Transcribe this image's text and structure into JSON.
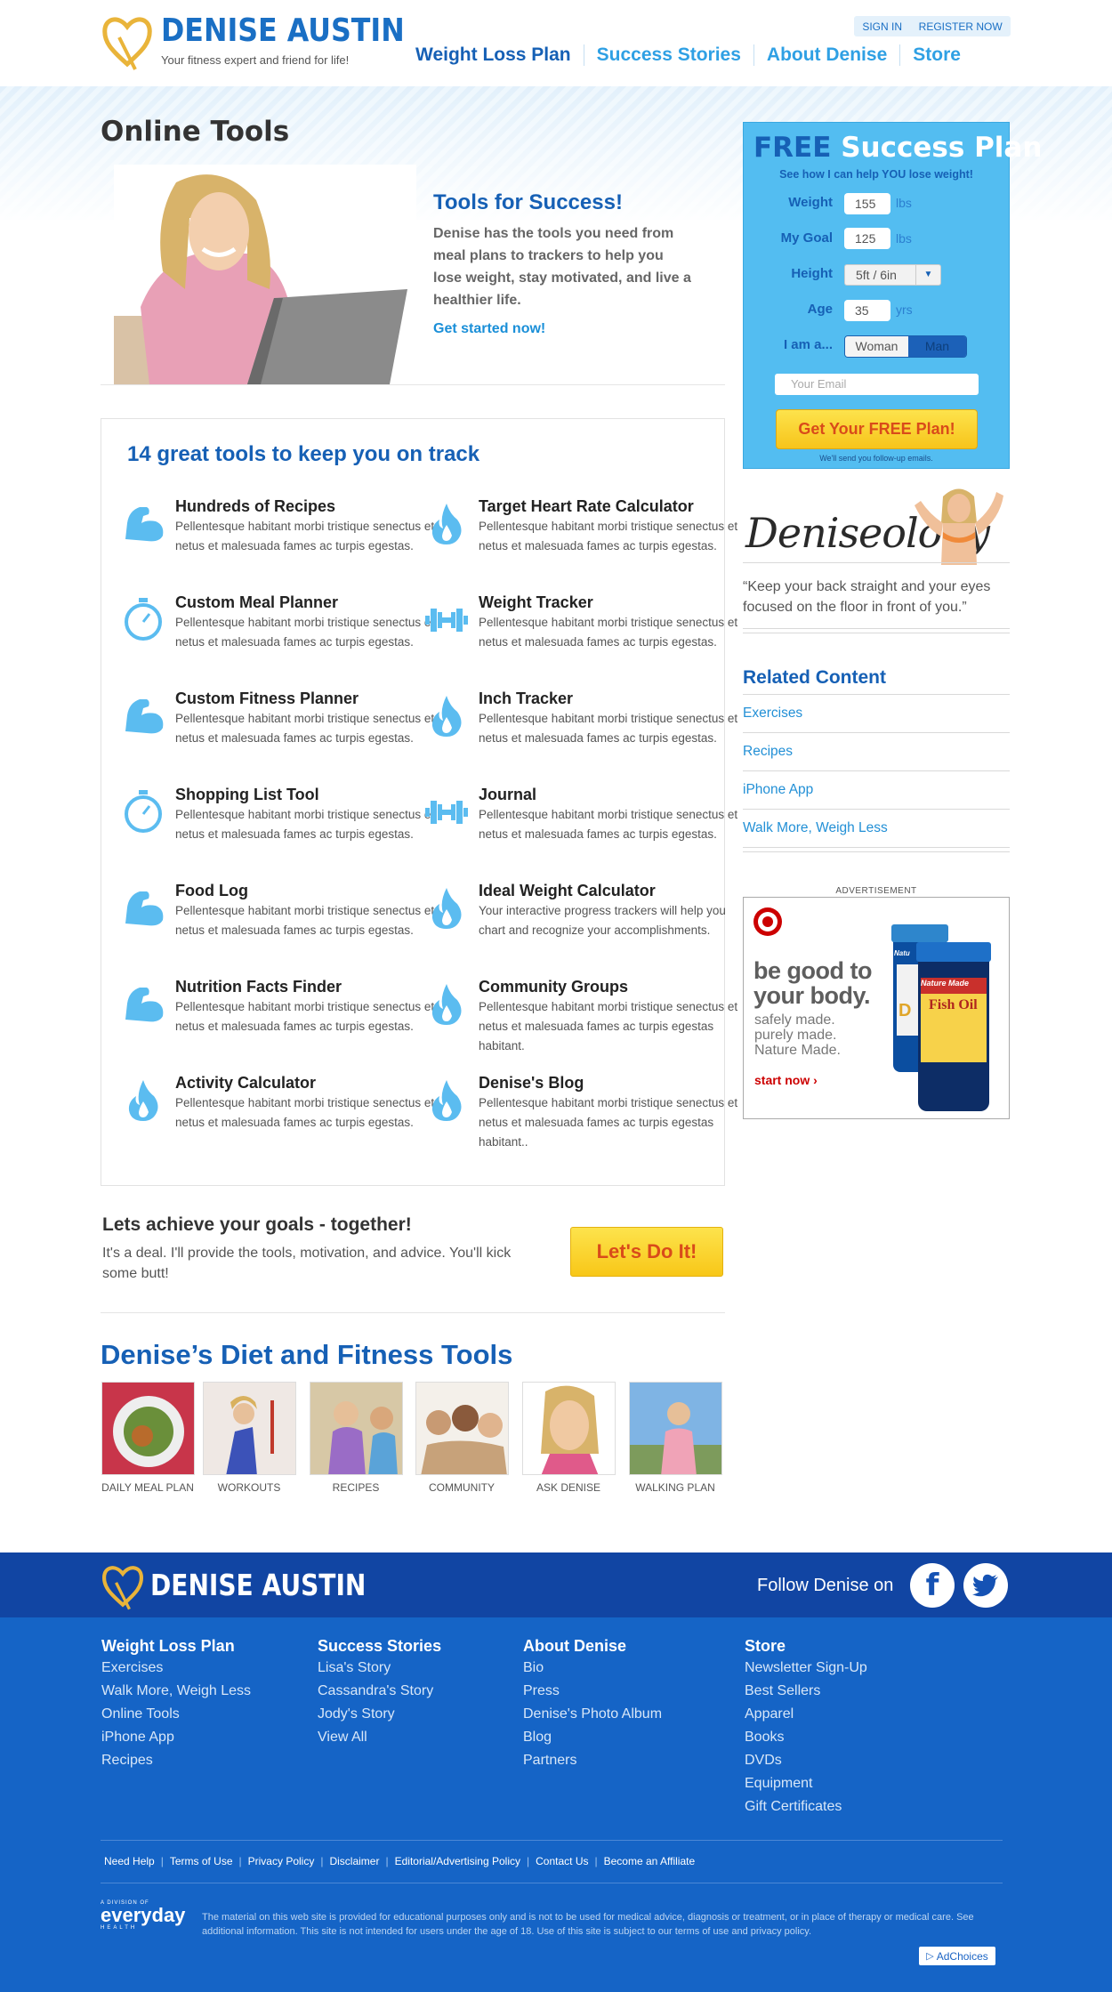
{
  "header": {
    "brand": "DENISE AUSTIN",
    "tagline": "Your fitness expert and friend for life!",
    "sign_in": "SIGN IN",
    "register": "REGISTER NOW",
    "nav": [
      "Weight Loss Plan",
      "Success Stories",
      "About Denise",
      "Store"
    ]
  },
  "page_title": "Online Tools",
  "hero": {
    "heading": "Tools for Success!",
    "body": "Denise has the tools you need from meal plans to trackers to help you lose weight, stay motivated, and live a healthier life.",
    "cta": "Get started now!"
  },
  "tools": {
    "title": "14 great tools to keep you on track",
    "items": [
      {
        "name": "Hundreds of Recipes",
        "desc": "Pellentesque habitant morbi tristique senectus et netus et malesuada fames ac turpis egestas.",
        "icon": "flexed-arm-icon"
      },
      {
        "name": "Target Heart Rate Calculator",
        "desc": "Pellentesque habitant morbi tristique senectus et netus et malesuada fames ac turpis egestas.",
        "icon": "flame-icon"
      },
      {
        "name": "Custom Meal Planner",
        "desc": "Pellentesque habitant morbi tristique senectus et netus et malesuada fames ac turpis egestas.",
        "icon": "stopwatch-icon"
      },
      {
        "name": "Weight Tracker",
        "desc": "Pellentesque habitant morbi tristique senectus et netus et malesuada fames ac turpis egestas.",
        "icon": "dumbbell-icon"
      },
      {
        "name": "Custom Fitness Planner",
        "desc": "Pellentesque habitant morbi tristique senectus et netus et malesuada fames ac turpis egestas.",
        "icon": "flexed-arm-icon"
      },
      {
        "name": "Inch Tracker",
        "desc": "Pellentesque habitant morbi tristique senectus et netus et malesuada fames ac turpis egestas.",
        "icon": "flame-icon"
      },
      {
        "name": "Shopping List Tool",
        "desc": "Pellentesque habitant morbi tristique senectus et netus et malesuada fames ac turpis egestas.",
        "icon": "stopwatch-icon"
      },
      {
        "name": "Journal",
        "desc": "Pellentesque habitant morbi tristique senectus et netus et malesuada fames ac turpis egestas.",
        "icon": "dumbbell-icon"
      },
      {
        "name": "Food Log",
        "desc": "Pellentesque habitant morbi tristique senectus et netus et malesuada fames ac turpis egestas.",
        "icon": "flexed-arm-icon"
      },
      {
        "name": "Ideal Weight Calculator",
        "desc": "Your interactive progress trackers will help you chart and recognize your accomplishments.",
        "icon": "flame-icon"
      },
      {
        "name": "Nutrition Facts Finder",
        "desc": "Pellentesque habitant morbi tristique senectus et netus et malesuada fames ac turpis egestas.",
        "icon": "flexed-arm-icon"
      },
      {
        "name": "Community Groups",
        "desc": "Pellentesque habitant morbi tristique senectus et netus et malesuada fames ac turpis egestas habitant.",
        "icon": "flame-icon"
      },
      {
        "name": "Activity Calculator",
        "desc": "Pellentesque habitant morbi tristique senectus et netus et malesuada fames ac turpis egestas.",
        "icon": "flame-icon"
      },
      {
        "name": "Denise's Blog",
        "desc": "Pellentesque habitant morbi tristique senectus et netus et malesuada fames ac turpis egestas habitant..",
        "icon": "flame-icon"
      }
    ]
  },
  "goals": {
    "heading": "Lets achieve your goals - together!",
    "body": "It's a deal.  I'll provide the tools, motivation, and advice.  You'll kick some butt!",
    "button": "Let's Do It!"
  },
  "diet_tools": {
    "title": "Denise’s Diet and Fitness Tools",
    "items": [
      "DAILY MEAL PLAN",
      "WORKOUTS",
      "RECIPES",
      "COMMUNITY",
      "ASK DENISE",
      "WALKING PLAN"
    ]
  },
  "plan": {
    "title_free": "FREE",
    "title_rest": "Success Plan",
    "subtitle": "See how I can help YOU lose weight!",
    "weight_label": "Weight",
    "weight_value": "155",
    "weight_unit": "lbs",
    "goal_label": "My Goal",
    "goal_value": "125",
    "goal_unit": "lbs",
    "height_label": "Height",
    "height_value": "5ft / 6in",
    "age_label": "Age",
    "age_value": "35",
    "age_unit": "yrs",
    "gender_label": "I am a...",
    "gender_woman": "Woman",
    "gender_man": "Man",
    "email_placeholder": "Your Email",
    "button": "Get Your FREE Plan!",
    "note": "We'll send you follow-up emails."
  },
  "deniseology": {
    "logo": "Deniseology",
    "quote": "“Keep your back straight and your eyes focused on the floor in front of you.”"
  },
  "related": {
    "title": "Related Content",
    "items": [
      "Exercises",
      "Recipes",
      "iPhone App",
      "Walk More, Weigh Less"
    ]
  },
  "ad": {
    "label": "ADVERTISEMENT",
    "headline": "be good to your body.",
    "sub1": "safely made.",
    "sub2": "purely made.",
    "sub3": "Nature Made.",
    "cta": "start now",
    "bottle_brand": "Nature Made",
    "bottle_product": "Fish Oil",
    "bottle_partial": "D",
    "bottle_partial_brand": "Natu"
  },
  "footer": {
    "brand": "DENISE AUSTIN",
    "follow": "Follow Denise on",
    "columns": [
      {
        "heading": "Weight Loss Plan",
        "links": [
          "Exercises",
          "Walk More, Weigh Less",
          "Online Tools",
          "iPhone App",
          "Recipes"
        ]
      },
      {
        "heading": "Success Stories",
        "links": [
          "Lisa's Story",
          "Cassandra's Story",
          "Jody's Story",
          "View All"
        ]
      },
      {
        "heading": "About Denise",
        "links": [
          "Bio",
          "Press",
          "Denise's Photo Album",
          "Blog",
          "Partners"
        ]
      },
      {
        "heading": "Store",
        "links": [
          "Newsletter Sign-Up",
          "Best Sellers",
          "Apparel",
          "Books",
          "DVDs",
          "Equipment",
          "Gift Certificates"
        ]
      }
    ],
    "bottom_links": [
      "Need Help",
      "Terms of Use",
      "Privacy Policy",
      "Disclaimer",
      "Editorial/Advertising Policy",
      "Contact Us",
      "Become an Affiliate"
    ],
    "division_small": "A DIVISION OF",
    "division_name": "everyday",
    "division_sub": "HEALTH",
    "legal": "The material on this web site is provided for educational purposes only and is not to be used for medical advice, diagnosis or treatment, or in place of therapy or medical care. See additional information. This site is not intended for users under the age of 18. Use of this site is subject to our terms of use and privacy policy.",
    "adchoices": "AdChoices"
  },
  "colors": {
    "brand_blue": "#1660b5",
    "link_blue": "#2fa0e4",
    "plan_blue": "#53bdf1",
    "footer_dark": "#1145a3",
    "footer": "#1564c6",
    "cta_yellow": "#f8c718",
    "cta_text": "#d94b1a"
  }
}
